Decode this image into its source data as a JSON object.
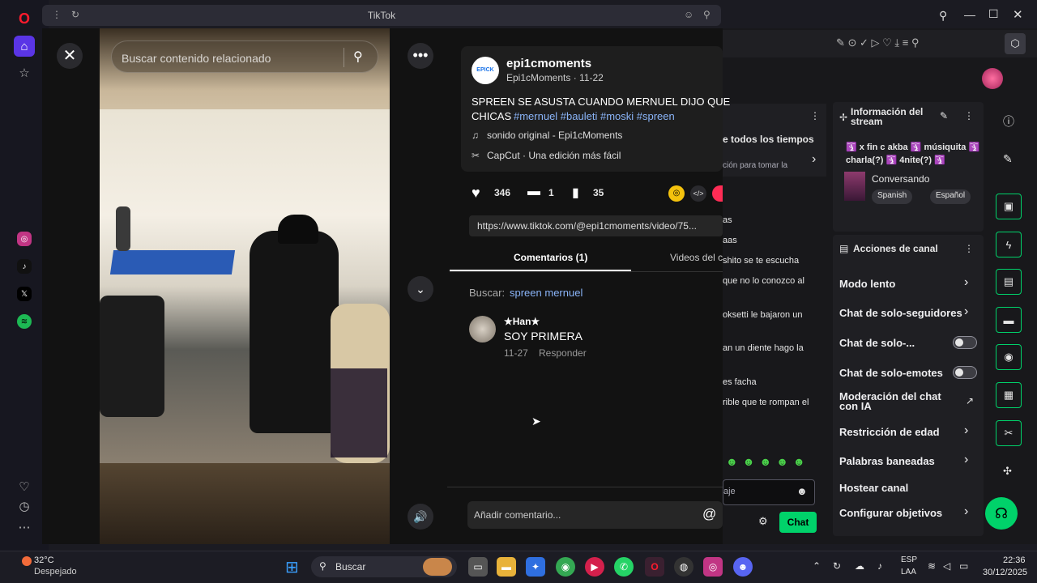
{
  "browser": {
    "tab_title": "TikTok"
  },
  "search": {
    "placeholder": "Buscar contenido relacionado"
  },
  "post": {
    "username": "epi1cmoments",
    "display_name_date": "Epi1cMoments · 11-22",
    "caption": "SPREEN SE ASUSTA CUANDO MERNUEL DIJO QUE",
    "caption_line2": "CHICAS",
    "hashtags": "#mernuel #bauleti #moski #spreen",
    "sound": "sonido original - Epi1cMoments",
    "capcut": "CapCut · Una edición más fácil",
    "likes": "346",
    "comments": "1",
    "saves": "35",
    "link": "https://www.tiktok.com/@epi1cmoments/video/75...",
    "avatar_text": "EPICK"
  },
  "tabs": {
    "comments": "Comentarios (1)",
    "videos": "Videos del c"
  },
  "search_bar": {
    "label": "Buscar:",
    "query": "spreen mernuel"
  },
  "comment": {
    "author": "★Han★",
    "text": "SOY PRIMERA",
    "date": "11-27",
    "reply": "Responder"
  },
  "add_comment": {
    "placeholder": "Añadir comentario..."
  },
  "stream_info": {
    "title": "Información del stream",
    "stream_title": "🛐 x fin c akba 🛐 músiquita 🛐 charla(?) 🛐 4nite(?) 🛐",
    "category": "Conversando",
    "tags": [
      "Spanish",
      "Español"
    ]
  },
  "leaderboard": {
    "title": "e todos los tiempos",
    "subtitle": "ción para tomar la"
  },
  "chat_partial": [
    "as",
    "aas",
    "shito se te escucha",
    "que no lo conozco al",
    "oksetti le bajaron un",
    "an un diente hago la",
    "es facha",
    "rible que te rompan el"
  ],
  "chat_input": {
    "placeholder": "aje",
    "button": "Chat"
  },
  "channel_actions": {
    "title": "Acciones de canal",
    "items": [
      {
        "label": "Modo lento",
        "control": "chevron"
      },
      {
        "label": "Chat de solo-seguidores",
        "control": "chevron"
      },
      {
        "label": "Chat de solo-...",
        "control": "toggle"
      },
      {
        "label": "Chat de solo-emotes",
        "control": "toggle"
      },
      {
        "label": "Moderación del chat con IA",
        "control": "link"
      },
      {
        "label": "Restricción de edad",
        "control": "chevron"
      },
      {
        "label": "Palabras baneadas",
        "control": "chevron"
      },
      {
        "label": "Hostear canal",
        "control": "none"
      },
      {
        "label": "Configurar objetivos",
        "control": "chevron"
      }
    ]
  },
  "weather": {
    "temp": "32°C",
    "desc": "Despejado"
  },
  "taskbar": {
    "search": "Buscar",
    "lang": "ESP",
    "lang2": "LAA",
    "time": "22:36",
    "date": "30/12/2025"
  },
  "colors": {
    "accent_green": "#00d26a",
    "link_blue": "#8ab4f8",
    "tiktok_red": "#fe2c55",
    "twitch_purple": "#9147ff"
  }
}
